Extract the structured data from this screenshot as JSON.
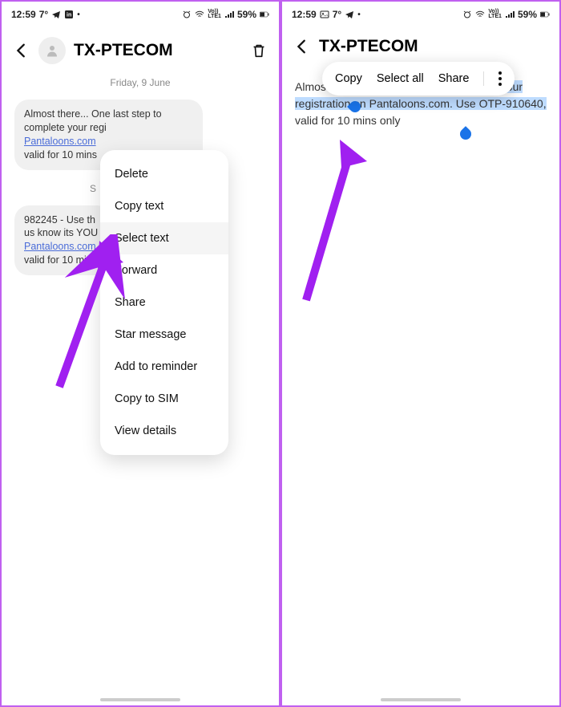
{
  "status": {
    "time": "12:59",
    "temp": "7°",
    "battery": "59%",
    "signal": "Vo LTE1"
  },
  "phone1": {
    "title": "TX-PTECOM",
    "date": "Friday, 9 June",
    "msg1": "Almost there... One last step to complete your regi",
    "msg1b": "Pantaloons.com",
    "msg1c": "valid for 10 mins",
    "sunday": "S",
    "msg2a": "982245 - Use th",
    "msg2b": "us know its YOU",
    "msg2c": "Pantaloons.com",
    "msg2d": "valid for 10 min",
    "menu": {
      "delete": "Delete",
      "copy": "Copy text",
      "select": "Select text",
      "forward": "Forward",
      "share": "Share",
      "star": "Star message",
      "reminder": "Add to reminder",
      "sim": "Copy to SIM",
      "details": "View details"
    }
  },
  "phone2": {
    "title": "TX-PTECOM",
    "toolbar": {
      "copy": "Copy",
      "selectall": "Select all",
      "share": "Share"
    },
    "text_pre": "Almost there... ",
    "text_sel": "One last step to complete your registration on Pantaloons.com. Use OTP-910640,",
    "text_post": " valid for 10 mins only"
  }
}
